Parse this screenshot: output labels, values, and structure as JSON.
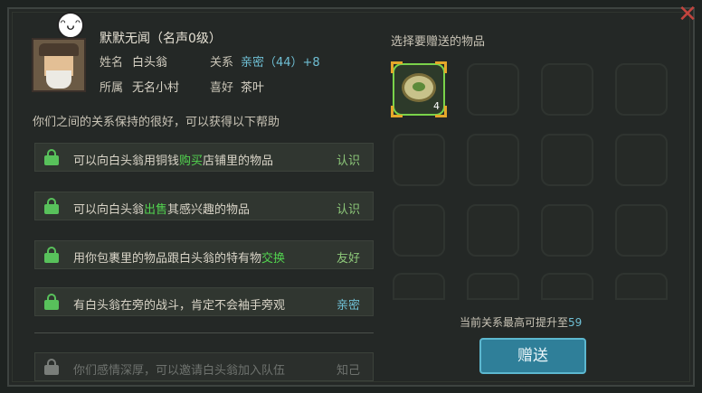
{
  "npc": {
    "title_line": "默默无闻（名声0级）",
    "name_label": "姓名",
    "name": "白头翁",
    "relation_label": "关系",
    "relation": "亲密（44）+8",
    "belong_label": "所属",
    "belong": "无名小村",
    "hobby_label": "喜好",
    "hobby": "茶叶"
  },
  "description": "你们之间的关系保持的很好，可以获得以下帮助",
  "benefits": [
    {
      "pre": "可以向白头翁用铜钱",
      "hl": "购买",
      "post": "店铺里的物品",
      "level": "认识"
    },
    {
      "pre": "可以向白头翁",
      "hl": "出售",
      "post": "其感兴趣的物品",
      "level": "认识"
    },
    {
      "pre": "用你包裹里的物品跟白头翁的特有物",
      "hl": "交换",
      "post": "",
      "level": "友好"
    },
    {
      "pre": "有白头翁在旁的战斗，肯定不会袖手旁观",
      "hl": "",
      "post": "",
      "level": "亲密"
    },
    {
      "pre": "你们感情深厚，可以邀请白头翁加入队伍",
      "hl": "",
      "post": "",
      "level": "知己"
    }
  ],
  "gift": {
    "title": "选择要赠送的物品",
    "item_count": "4",
    "item_icon": "tea-leaf-icon",
    "max_text": "当前关系最高可提升至",
    "max_value": "59",
    "button_label": "赠送"
  },
  "colors": {
    "highlight": "#52d34f",
    "relation": "#6fbfd4",
    "button": "#2f7f99"
  }
}
